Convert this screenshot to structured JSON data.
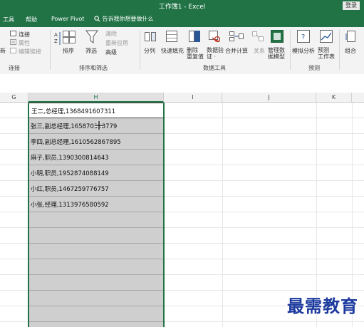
{
  "window": {
    "title": "工作簿1 - Excel",
    "login_label": "登录"
  },
  "tabs": [
    "工具",
    "帮助",
    "Power Pivot"
  ],
  "tell_me": "告诉我你想要做什么",
  "ribbon": {
    "connections": {
      "connections": "连接",
      "properties": "属性",
      "edit_links": "编辑链接",
      "group": "连接",
      "left_clip": "新"
    },
    "sort_filter": {
      "sort_az": "A↓Z",
      "sort": "排序",
      "filter": "筛选",
      "clear": "清除",
      "reapply": "重新应用",
      "advanced": "高级",
      "group": "排序和筛选"
    },
    "data_tools": {
      "split": "分列",
      "flash_fill": "快速填充",
      "remove_dup": "删除\n重复值",
      "validation": "数据验\n证 ·",
      "consolidate": "合并计算",
      "relationships": "关系",
      "data_model": "管理数\n据模型",
      "group": "数据工具"
    },
    "forecast": {
      "whatif": "模拟分析",
      "forecast_sheet": "预测\n工作表",
      "group": "预测"
    },
    "outline": {
      "group_btn": "组合"
    }
  },
  "columns": [
    "G",
    "H",
    "I",
    "J",
    "K"
  ],
  "cells": [
    "王二,总经理,13684916073​11",
    "张三,副总经理,1658703​68779",
    "李四,副总经理,1610562867895",
    "麻子,职员,1390300814643",
    "小明,职员,1952874088149",
    "小红,职员,1467259776757",
    "小张,经理,1313976580592"
  ],
  "watermark": "最需教育"
}
